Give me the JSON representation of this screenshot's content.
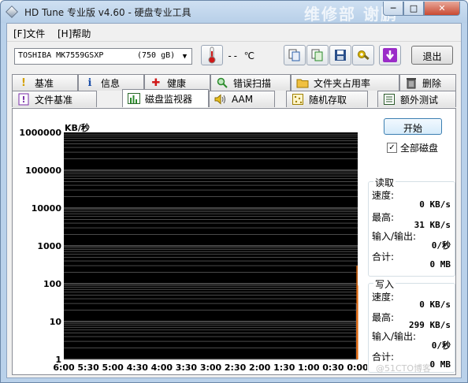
{
  "window": {
    "title": "HD Tune 专业版 v4.60 - 硬盘专业工具",
    "watermark": "维修部 谢鹏",
    "min_glyph": "─",
    "max_glyph": "□",
    "close_glyph": "✕"
  },
  "menu": [
    {
      "label": "[F]文件"
    },
    {
      "label": "[H]帮助"
    }
  ],
  "toolbar": {
    "drive_name": "TOSHIBA MK7559GSXP",
    "drive_capacity": "(750 gB)",
    "temperature": "-- ℃",
    "exit_label": "退出"
  },
  "tabs_row1": [
    {
      "label": "基准",
      "icon": "exclamation-icon",
      "glyph": "!",
      "color": "#d4a000"
    },
    {
      "label": "信息",
      "icon": "info-icon",
      "glyph": "i",
      "color": "#1c4fa8"
    },
    {
      "label": "健康",
      "icon": "health-cross-icon",
      "glyph": "✚",
      "color": "#d01818"
    },
    {
      "label": "错误扫描",
      "icon": "magnifier-icon",
      "glyph": "🔍",
      "color": "#2a8a2a"
    },
    {
      "label": "文件夹占用率",
      "icon": "folder-icon",
      "glyph": "📁",
      "color": "#d8a020"
    },
    {
      "label": "删除",
      "icon": "trash-icon",
      "glyph": "🗑",
      "color": "#555555"
    }
  ],
  "tabs_row2": [
    {
      "label": "文件基准",
      "icon": "file-benchmark-icon",
      "glyph": "!",
      "color": "#9a2ca8"
    },
    {
      "label": "磁盘监视器",
      "icon": "disk-monitor-icon",
      "glyph": "▮",
      "color": "#2a8a2a"
    },
    {
      "label": "AAM",
      "icon": "speaker-icon",
      "glyph": "🔊",
      "color": "#c8a000"
    },
    {
      "label": "随机存取",
      "icon": "random-access-icon",
      "glyph": "▦",
      "color": "#c8a000"
    },
    {
      "label": "额外测试",
      "icon": "extra-tests-icon",
      "glyph": "▤",
      "color": "#2a6a2a"
    }
  ],
  "monitor": {
    "start_label": "开始",
    "all_disks_label": "全部磁盘",
    "all_disks_checked": true,
    "read": {
      "title": "读取",
      "speed_label": "速度:",
      "speed_value": "0 KB/s",
      "max_label": "最高:",
      "max_value": "31 KB/s",
      "io_label": "输入/输出:",
      "io_value": "0/秒",
      "total_label": "合计:",
      "total_value": "0 MB"
    },
    "write": {
      "title": "写入",
      "speed_label": "速度:",
      "speed_value": "0 KB/s",
      "max_label": "最高:",
      "max_value": "299 KB/s",
      "io_label": "输入/输出:",
      "io_value": "0/秒",
      "total_label": "合计:",
      "total_value": "0 MB"
    }
  },
  "site_watermark": "@51CTO博客",
  "chart_data": {
    "type": "bar",
    "ylabel": "KB/秒",
    "yscale": "log",
    "ylim": [
      1,
      1000000
    ],
    "y_ticks": [
      "1000000",
      "100000",
      "10000",
      "1000",
      "100",
      "10",
      "1"
    ],
    "y_tick_values": [
      1000000,
      100000,
      10000,
      1000,
      100,
      10,
      1
    ],
    "x_ticks": [
      "6:00",
      "5:30",
      "5:00",
      "4:30",
      "4:00",
      "3:30",
      "3:00",
      "2:30",
      "2:00",
      "1:30",
      "1:00",
      "0:30",
      "0:00"
    ],
    "x_unit": "minutes before now",
    "xlim": [
      360,
      0
    ],
    "background": "#000000",
    "grid": true,
    "series": [
      {
        "color": "#4a8fd8",
        "points": [
          {
            "x": 1.4,
            "y": 30
          }
        ]
      },
      {
        "color": "#e06a10",
        "points": [
          {
            "x": 0.9,
            "y": 300
          },
          {
            "x": 0.6,
            "y": 60
          },
          {
            "x": 0.3,
            "y": 80
          },
          {
            "x": 1.1,
            "y": 20
          },
          {
            "x": 0.15,
            "y": 90
          }
        ]
      }
    ]
  }
}
